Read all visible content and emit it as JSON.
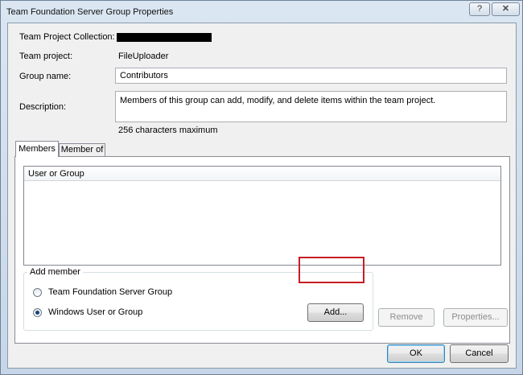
{
  "window": {
    "title": "Team Foundation Server Group Properties",
    "help_label": "?",
    "close_label": "✕"
  },
  "fields": {
    "collection_label": "Team Project Collection:",
    "project_label": "Team project:",
    "project_value": "FileUploader",
    "group_name_label": "Group name:",
    "group_name_value": "Contributors",
    "description_label": "Description:",
    "description_value": "Members of this group can add, modify, and delete items within the team project.",
    "char_limit_note": "256 characters maximum"
  },
  "tabs": [
    {
      "label": "Members",
      "active": true
    },
    {
      "label": "Member of",
      "active": false
    }
  ],
  "members_list": {
    "column_header": "User or Group",
    "rows": []
  },
  "add_member": {
    "title": "Add member",
    "options": [
      {
        "label": "Team Foundation Server Group",
        "selected": false
      },
      {
        "label": "Windows User or Group",
        "selected": true
      }
    ],
    "add_button": "Add...",
    "remove_button": "Remove",
    "properties_button": "Properties..."
  },
  "footer": {
    "ok_button": "OK",
    "cancel_button": "Cancel"
  },
  "colors": {
    "highlight": "#c81d25",
    "window_frame": "#c6d6e8"
  }
}
